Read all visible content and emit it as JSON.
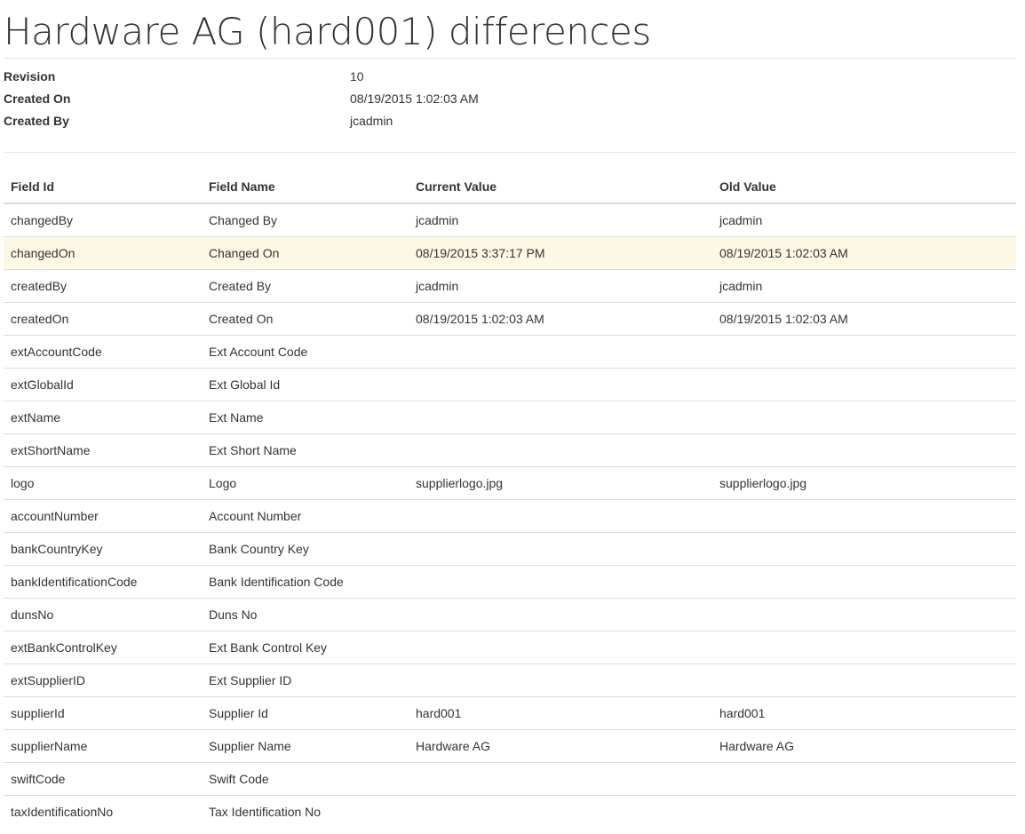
{
  "page": {
    "title": "Hardware AG (hard001) differences"
  },
  "meta": [
    {
      "label": "Revision",
      "value": "10"
    },
    {
      "label": "Created On",
      "value": "08/19/2015 1:02:03 AM"
    },
    {
      "label": "Created By",
      "value": "jcadmin"
    }
  ],
  "table": {
    "headers": [
      "Field Id",
      "Field Name",
      "Current Value",
      "Old Value"
    ],
    "rows": [
      {
        "field_id": "changedBy",
        "field_name": "Changed By",
        "current": "jcadmin",
        "old": "jcadmin",
        "changed": false
      },
      {
        "field_id": "changedOn",
        "field_name": "Changed On",
        "current": "08/19/2015 3:37:17 PM",
        "old": "08/19/2015 1:02:03 AM",
        "changed": true
      },
      {
        "field_id": "createdBy",
        "field_name": "Created By",
        "current": "jcadmin",
        "old": "jcadmin",
        "changed": false
      },
      {
        "field_id": "createdOn",
        "field_name": "Created On",
        "current": "08/19/2015 1:02:03 AM",
        "old": "08/19/2015 1:02:03 AM",
        "changed": false
      },
      {
        "field_id": "extAccountCode",
        "field_name": "Ext Account Code",
        "current": "",
        "old": "",
        "changed": false
      },
      {
        "field_id": "extGlobalId",
        "field_name": "Ext Global Id",
        "current": "",
        "old": "",
        "changed": false
      },
      {
        "field_id": "extName",
        "field_name": "Ext Name",
        "current": "",
        "old": "",
        "changed": false
      },
      {
        "field_id": "extShortName",
        "field_name": "Ext Short Name",
        "current": "",
        "old": "",
        "changed": false
      },
      {
        "field_id": "logo",
        "field_name": "Logo",
        "current": "supplierlogo.jpg",
        "old": "supplierlogo.jpg",
        "changed": false
      },
      {
        "field_id": "accountNumber",
        "field_name": "Account Number",
        "current": "",
        "old": "",
        "changed": false
      },
      {
        "field_id": "bankCountryKey",
        "field_name": "Bank Country Key",
        "current": "",
        "old": "",
        "changed": false
      },
      {
        "field_id": "bankIdentificationCode",
        "field_name": "Bank Identification Code",
        "current": "",
        "old": "",
        "changed": false
      },
      {
        "field_id": "dunsNo",
        "field_name": "Duns No",
        "current": "",
        "old": "",
        "changed": false
      },
      {
        "field_id": "extBankControlKey",
        "field_name": "Ext Bank Control Key",
        "current": "",
        "old": "",
        "changed": false
      },
      {
        "field_id": "extSupplierID",
        "field_name": "Ext Supplier ID",
        "current": "",
        "old": "",
        "changed": false
      },
      {
        "field_id": "supplierId",
        "field_name": "Supplier Id",
        "current": "hard001",
        "old": "hard001",
        "changed": false
      },
      {
        "field_id": "supplierName",
        "field_name": "Supplier Name",
        "current": "Hardware AG",
        "old": "Hardware AG",
        "changed": false
      },
      {
        "field_id": "swiftCode",
        "field_name": "Swift Code",
        "current": "",
        "old": "",
        "changed": false
      },
      {
        "field_id": "taxIdentificationNo",
        "field_name": "Tax Identification No",
        "current": "",
        "old": "",
        "changed": false
      }
    ]
  },
  "colors": {
    "changed_row": "#fcf8e3",
    "border": "#dddddd",
    "text": "#333333"
  }
}
